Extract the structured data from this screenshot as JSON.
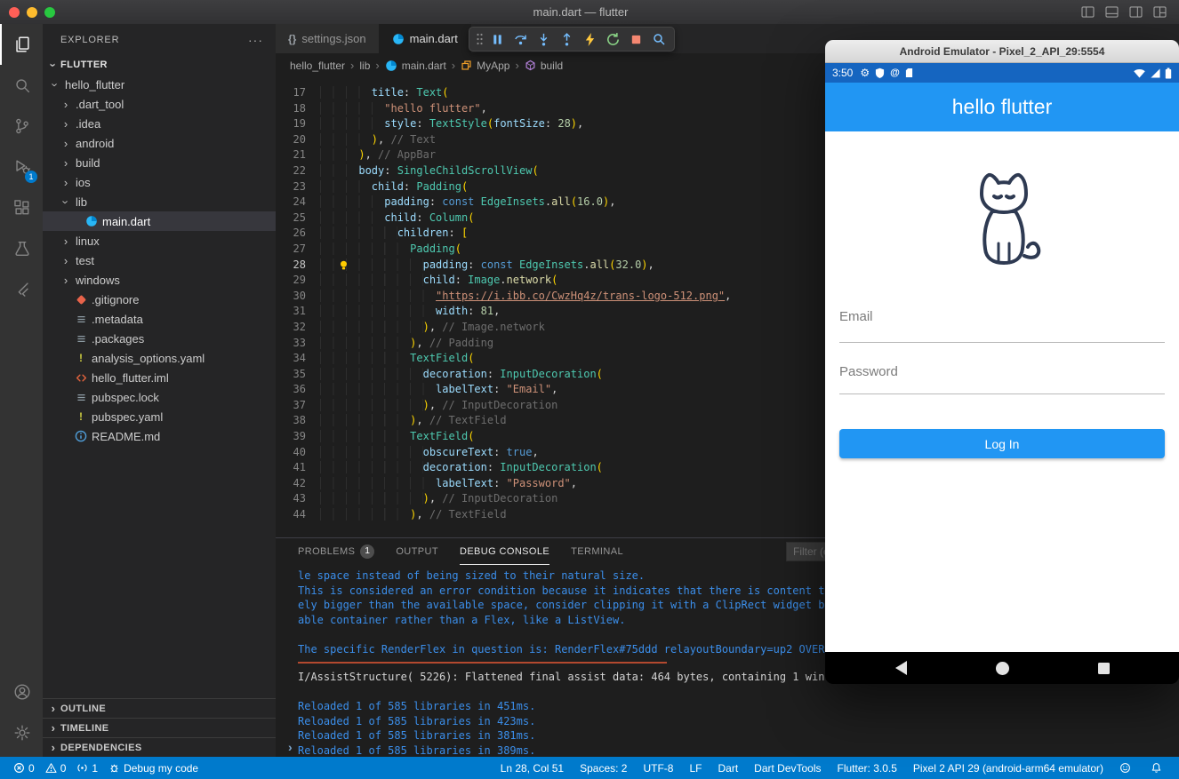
{
  "window": {
    "title": "main.dart — flutter",
    "controls": [
      {
        "id": "toggle-primary-sidebar",
        "icon": "wcleft"
      },
      {
        "id": "toggle-panel",
        "icon": "wcpanel"
      },
      {
        "id": "toggle-secondary-sidebar",
        "icon": "wcright"
      },
      {
        "id": "customize-layout",
        "icon": "wcgrid"
      }
    ]
  },
  "activity_bar": {
    "items": [
      {
        "id": "explorer",
        "icon": "files",
        "active": true
      },
      {
        "id": "search",
        "icon": "search"
      },
      {
        "id": "source-control",
        "icon": "branch"
      },
      {
        "id": "run-and-debug",
        "icon": "debug",
        "badge": "1"
      },
      {
        "id": "extensions",
        "icon": "extensions"
      },
      {
        "id": "testing",
        "icon": "beaker"
      },
      {
        "id": "flutter",
        "icon": "flutter"
      }
    ],
    "bottom": [
      {
        "id": "accounts",
        "icon": "account"
      },
      {
        "id": "settings",
        "icon": "gear"
      }
    ]
  },
  "sidebar": {
    "title": "EXPLORER",
    "section": "FLUTTER",
    "tree": [
      {
        "label": "hello_flutter",
        "depth": 0,
        "arrow": "down"
      },
      {
        "label": ".dart_tool",
        "depth": 1,
        "arrow": "right"
      },
      {
        "label": ".idea",
        "depth": 1,
        "arrow": "right"
      },
      {
        "label": "android",
        "depth": 1,
        "arrow": "right"
      },
      {
        "label": "build",
        "depth": 1,
        "arrow": "right"
      },
      {
        "label": "ios",
        "depth": 1,
        "arrow": "right"
      },
      {
        "label": "lib",
        "depth": 1,
        "arrow": "down"
      },
      {
        "label": "main.dart",
        "depth": 2,
        "icon": "dart",
        "selected": true
      },
      {
        "label": "linux",
        "depth": 1,
        "arrow": "right"
      },
      {
        "label": "test",
        "depth": 1,
        "arrow": "right"
      },
      {
        "label": "windows",
        "depth": 1,
        "arrow": "right"
      },
      {
        "label": ".gitignore",
        "depth": 1,
        "icon": "git"
      },
      {
        "label": ".metadata",
        "depth": 1,
        "icon": "textfile"
      },
      {
        "label": ".packages",
        "depth": 1,
        "icon": "textfile"
      },
      {
        "label": "analysis_options.yaml",
        "depth": 1,
        "icon": "yaml"
      },
      {
        "label": "hello_flutter.iml",
        "depth": 1,
        "icon": "iml"
      },
      {
        "label": "pubspec.lock",
        "depth": 1,
        "icon": "textfile"
      },
      {
        "label": "pubspec.yaml",
        "depth": 1,
        "icon": "yaml"
      },
      {
        "label": "README.md",
        "depth": 1,
        "icon": "info"
      }
    ],
    "bottom_sections": [
      "OUTLINE",
      "TIMELINE",
      "DEPENDENCIES"
    ]
  },
  "tabs": [
    {
      "label": "settings.json",
      "icon": "braces",
      "active": false
    },
    {
      "label": "main.dart",
      "icon": "dart",
      "active": true
    }
  ],
  "debug_toolbar": [
    {
      "id": "drag-handle",
      "icon": "gripper"
    },
    {
      "id": "pause",
      "icon": "pause"
    },
    {
      "id": "step-over",
      "icon": "stepover"
    },
    {
      "id": "step-into",
      "icon": "stepinto"
    },
    {
      "id": "step-out",
      "icon": "stepout"
    },
    {
      "id": "hot-reload",
      "icon": "bolt"
    },
    {
      "id": "restart",
      "icon": "restart"
    },
    {
      "id": "stop",
      "icon": "stop"
    },
    {
      "id": "open-devtools",
      "icon": "inspect"
    }
  ],
  "breadcrumbs": [
    {
      "label": "hello_flutter"
    },
    {
      "label": "lib"
    },
    {
      "label": "main.dart",
      "icon": "dart"
    },
    {
      "label": "MyApp",
      "icon": "symclass"
    },
    {
      "label": "build",
      "icon": "symmethod"
    }
  ],
  "editor": {
    "current_line": 28,
    "lines": [
      {
        "num": 17,
        "tokens": [
          [
            "ind",
            "        "
          ],
          [
            "prop",
            "title"
          ],
          [
            "pln",
            ": "
          ],
          [
            "cls",
            "Text"
          ],
          [
            "brk",
            "("
          ]
        ]
      },
      {
        "num": 18,
        "tokens": [
          [
            "ind",
            "          "
          ],
          [
            "str",
            "\"hello flutter\""
          ],
          [
            "pln",
            ","
          ]
        ]
      },
      {
        "num": 19,
        "tokens": [
          [
            "ind",
            "          "
          ],
          [
            "prop",
            "style"
          ],
          [
            "pln",
            ": "
          ],
          [
            "cls",
            "TextStyle"
          ],
          [
            "brk",
            "("
          ],
          [
            "prop",
            "fontSize"
          ],
          [
            "pln",
            ": "
          ],
          [
            "num",
            "28"
          ],
          [
            "brk",
            ")"
          ],
          [
            "pln",
            ","
          ]
        ]
      },
      {
        "num": 20,
        "tokens": [
          [
            "ind",
            "        "
          ],
          [
            "brk",
            ")"
          ],
          [
            "pln",
            ","
          ],
          [
            "cmt",
            " // Text"
          ]
        ]
      },
      {
        "num": 21,
        "tokens": [
          [
            "ind",
            "      "
          ],
          [
            "brk",
            ")"
          ],
          [
            "pln",
            ","
          ],
          [
            "cmt",
            " // AppBar"
          ]
        ]
      },
      {
        "num": 22,
        "tokens": [
          [
            "ind",
            "      "
          ],
          [
            "prop",
            "body"
          ],
          [
            "pln",
            ": "
          ],
          [
            "cls",
            "SingleChildScrollView"
          ],
          [
            "brk",
            "("
          ]
        ]
      },
      {
        "num": 23,
        "tokens": [
          [
            "ind",
            "        "
          ],
          [
            "prop",
            "child"
          ],
          [
            "pln",
            ": "
          ],
          [
            "cls",
            "Padding"
          ],
          [
            "brk",
            "("
          ]
        ]
      },
      {
        "num": 24,
        "tokens": [
          [
            "ind",
            "          "
          ],
          [
            "prop",
            "padding"
          ],
          [
            "pln",
            ": "
          ],
          [
            "kw",
            "const"
          ],
          [
            "pln",
            " "
          ],
          [
            "cls",
            "EdgeInsets"
          ],
          [
            "pln",
            "."
          ],
          [
            "mth",
            "all"
          ],
          [
            "brk",
            "("
          ],
          [
            "num",
            "16.0"
          ],
          [
            "brk",
            ")"
          ],
          [
            "pln",
            ","
          ]
        ]
      },
      {
        "num": 25,
        "tokens": [
          [
            "ind",
            "          "
          ],
          [
            "prop",
            "child"
          ],
          [
            "pln",
            ": "
          ],
          [
            "cls",
            "Column"
          ],
          [
            "brk",
            "("
          ]
        ]
      },
      {
        "num": 26,
        "tokens": [
          [
            "ind",
            "            "
          ],
          [
            "prop",
            "children"
          ],
          [
            "pln",
            ": "
          ],
          [
            "brk",
            "["
          ]
        ]
      },
      {
        "num": 27,
        "tokens": [
          [
            "ind",
            "              "
          ],
          [
            "cls",
            "Padding"
          ],
          [
            "brk",
            "("
          ]
        ]
      },
      {
        "num": 28,
        "bulb": true,
        "tokens": [
          [
            "ind",
            "                "
          ],
          [
            "prop",
            "padding"
          ],
          [
            "pln",
            ": "
          ],
          [
            "kw",
            "const"
          ],
          [
            "pln",
            " "
          ],
          [
            "cls",
            "EdgeInsets"
          ],
          [
            "pln",
            "."
          ],
          [
            "mth",
            "all"
          ],
          [
            "brk",
            "("
          ],
          [
            "num",
            "32.0"
          ],
          [
            "brk",
            ")"
          ],
          [
            "pln",
            ","
          ]
        ]
      },
      {
        "num": 29,
        "tokens": [
          [
            "ind",
            "                "
          ],
          [
            "prop",
            "child"
          ],
          [
            "pln",
            ": "
          ],
          [
            "cls",
            "Image"
          ],
          [
            "pln",
            "."
          ],
          [
            "mth",
            "network"
          ],
          [
            "brk",
            "("
          ]
        ]
      },
      {
        "num": 30,
        "tokens": [
          [
            "ind",
            "                  "
          ],
          [
            "strl",
            "\"https://i.ibb.co/CwzHq4z/trans-logo-512.png\""
          ],
          [
            "pln",
            ","
          ]
        ]
      },
      {
        "num": 31,
        "tokens": [
          [
            "ind",
            "                  "
          ],
          [
            "prop",
            "width"
          ],
          [
            "pln",
            ": "
          ],
          [
            "num",
            "81"
          ],
          [
            "pln",
            ","
          ]
        ]
      },
      {
        "num": 32,
        "tokens": [
          [
            "ind",
            "                "
          ],
          [
            "brk",
            ")"
          ],
          [
            "pln",
            ","
          ],
          [
            "cmt",
            " // Image.network"
          ]
        ]
      },
      {
        "num": 33,
        "tokens": [
          [
            "ind",
            "              "
          ],
          [
            "brk",
            ")"
          ],
          [
            "pln",
            ","
          ],
          [
            "cmt",
            " // Padding"
          ]
        ]
      },
      {
        "num": 34,
        "tokens": [
          [
            "ind",
            "              "
          ],
          [
            "cls",
            "TextField"
          ],
          [
            "brk",
            "("
          ]
        ]
      },
      {
        "num": 35,
        "tokens": [
          [
            "ind",
            "                "
          ],
          [
            "prop",
            "decoration"
          ],
          [
            "pln",
            ": "
          ],
          [
            "cls",
            "InputDecoration"
          ],
          [
            "brk",
            "("
          ]
        ]
      },
      {
        "num": 36,
        "tokens": [
          [
            "ind",
            "                  "
          ],
          [
            "prop",
            "labelText"
          ],
          [
            "pln",
            ": "
          ],
          [
            "str",
            "\"Email\""
          ],
          [
            "pln",
            ","
          ]
        ]
      },
      {
        "num": 37,
        "tokens": [
          [
            "ind",
            "                "
          ],
          [
            "brk",
            ")"
          ],
          [
            "pln",
            ","
          ],
          [
            "cmt",
            " // InputDecoration"
          ]
        ]
      },
      {
        "num": 38,
        "tokens": [
          [
            "ind",
            "              "
          ],
          [
            "brk",
            ")"
          ],
          [
            "pln",
            ","
          ],
          [
            "cmt",
            " // TextField"
          ]
        ]
      },
      {
        "num": 39,
        "tokens": [
          [
            "ind",
            "              "
          ],
          [
            "cls",
            "TextField"
          ],
          [
            "brk",
            "("
          ]
        ]
      },
      {
        "num": 40,
        "tokens": [
          [
            "ind",
            "                "
          ],
          [
            "prop",
            "obscureText"
          ],
          [
            "pln",
            ": "
          ],
          [
            "kw",
            "true"
          ],
          [
            "pln",
            ","
          ]
        ]
      },
      {
        "num": 41,
        "tokens": [
          [
            "ind",
            "                "
          ],
          [
            "prop",
            "decoration"
          ],
          [
            "pln",
            ": "
          ],
          [
            "cls",
            "InputDecoration"
          ],
          [
            "brk",
            "("
          ]
        ]
      },
      {
        "num": 42,
        "tokens": [
          [
            "ind",
            "                  "
          ],
          [
            "prop",
            "labelText"
          ],
          [
            "pln",
            ": "
          ],
          [
            "str",
            "\"Password\""
          ],
          [
            "pln",
            ","
          ]
        ]
      },
      {
        "num": 43,
        "tokens": [
          [
            "ind",
            "                "
          ],
          [
            "brk",
            ")"
          ],
          [
            "pln",
            ","
          ],
          [
            "cmt",
            " // InputDecoration"
          ]
        ]
      },
      {
        "num": 44,
        "tokens": [
          [
            "ind",
            "              "
          ],
          [
            "brk",
            ")"
          ],
          [
            "pln",
            ","
          ],
          [
            "cmt",
            " // TextField"
          ]
        ]
      }
    ]
  },
  "panel": {
    "tabs": [
      {
        "label": "PROBLEMS",
        "badge": "1"
      },
      {
        "label": "OUTPUT"
      },
      {
        "label": "DEBUG CONSOLE",
        "active": true
      },
      {
        "label": "TERMINAL"
      }
    ],
    "filter_placeholder": "Filter (e.g. text, !exclude)",
    "prompt": "›",
    "console": [
      {
        "style": "info",
        "text": "le space instead of being sized to their natural size."
      },
      {
        "style": "info",
        "text": "This is considered an error condition because it indicates that there is content t"
      },
      {
        "style": "info",
        "text": "ely bigger than the available space, consider clipping it with a ClipRect widget b"
      },
      {
        "style": "info",
        "text": "able container rather than a Flex, like a ListView."
      },
      {
        "style": "info",
        "text": ""
      },
      {
        "style": "info",
        "text": "The specific RenderFlex in question is: RenderFlex#75ddd relayoutBoundary=up2 OVER"
      },
      {
        "style": "rule",
        "text": ""
      },
      {
        "style": "log",
        "text": "I/AssistStructure( 5226): Flattened final assist data: 464 bytes, containing 1 win"
      },
      {
        "style": "info",
        "text": ""
      },
      {
        "style": "info",
        "text": "Reloaded 1 of 585 libraries in 451ms."
      },
      {
        "style": "info",
        "text": "Reloaded 1 of 585 libraries in 423ms."
      },
      {
        "style": "info",
        "text": "Reloaded 1 of 585 libraries in 381ms."
      },
      {
        "style": "info",
        "text": "Reloaded 1 of 585 libraries in 389ms."
      }
    ]
  },
  "status_bar": {
    "left": [
      {
        "id": "errors",
        "icon": "error",
        "text": "0"
      },
      {
        "id": "warnings",
        "icon": "warning",
        "text": "0"
      },
      {
        "id": "ports",
        "icon": "port",
        "text": "1"
      },
      {
        "id": "debug-config",
        "icon": "bug",
        "text": "Debug my code"
      }
    ],
    "right": [
      {
        "id": "cursor-position",
        "text": "Ln 28, Col 51"
      },
      {
        "id": "indentation",
        "text": "Spaces: 2"
      },
      {
        "id": "encoding",
        "text": "UTF-8"
      },
      {
        "id": "eol",
        "text": "LF"
      },
      {
        "id": "language-mode",
        "text": "Dart"
      },
      {
        "id": "dart-devtools",
        "text": "Dart DevTools"
      },
      {
        "id": "flutter-version",
        "text": "Flutter: 3.0.5"
      },
      {
        "id": "device",
        "text": "Pixel 2 API 29 (android-arm64 emulator)"
      },
      {
        "id": "feedback",
        "icon": "feedback",
        "text": ""
      },
      {
        "id": "notifications",
        "icon": "bell",
        "text": ""
      }
    ]
  },
  "emulator": {
    "title": "Android Emulator - Pixel_2_API_29:5554",
    "status_time": "3:50",
    "app_title": "hello flutter",
    "email_label": "Email",
    "password_label": "Password",
    "login_label": "Log In"
  },
  "colors": {
    "vscode_status_bar": "#007acc",
    "activity_badge": "#007acc",
    "emulator_status_bar": "#1565c0",
    "emulator_app_bar": "#2196f3",
    "login_button": "#2196f3",
    "console_info": "#3b8eea",
    "exception_divider": "#b3492f"
  }
}
